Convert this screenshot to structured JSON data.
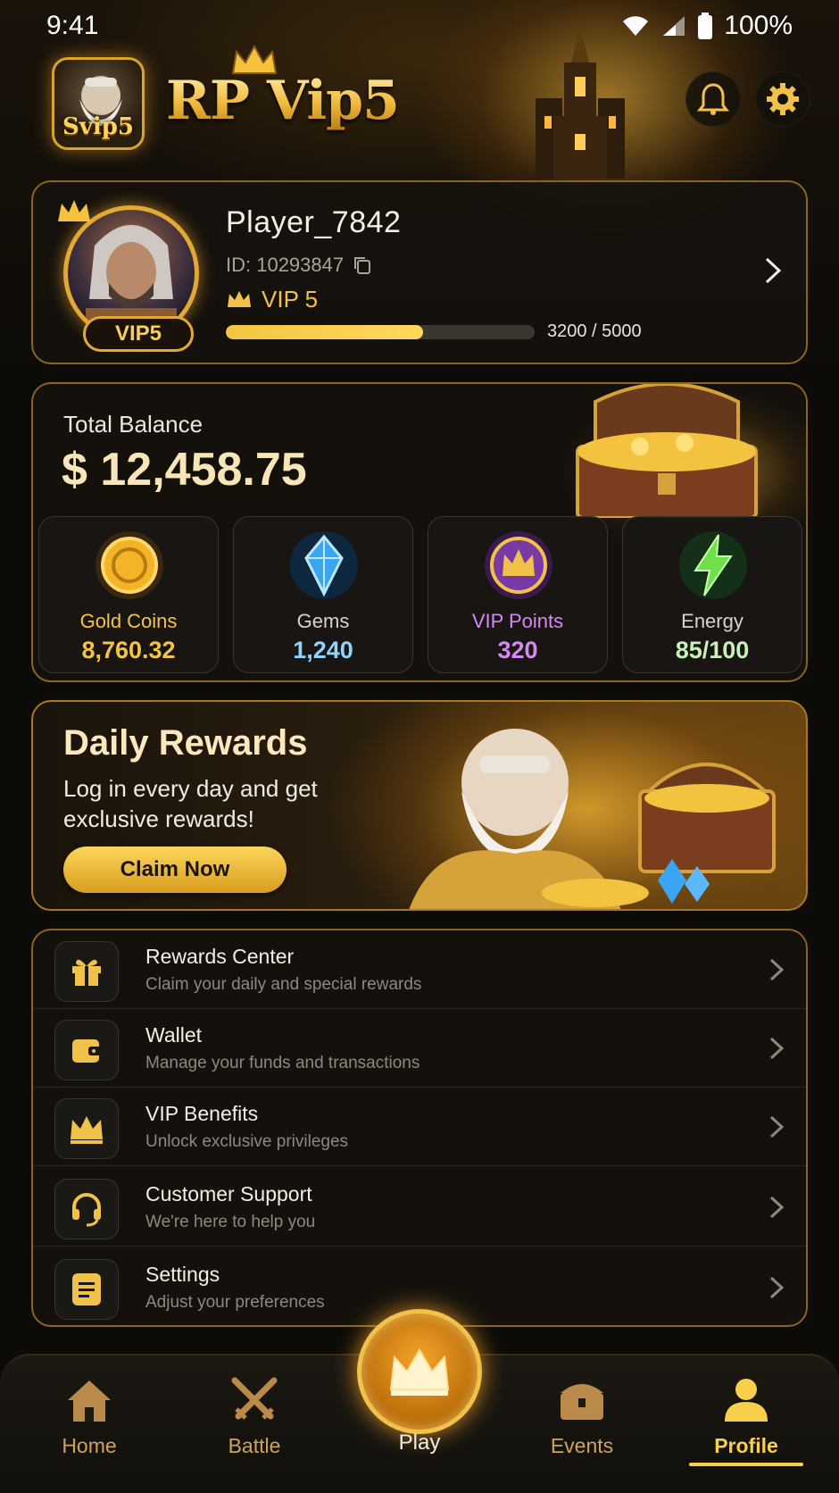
{
  "status_bar": {
    "time": "9:41",
    "battery": "100%"
  },
  "header": {
    "brand_title": "RP Vip5",
    "logo_text": "Svip5"
  },
  "profile": {
    "name": "Player_7842",
    "id_text": "ID: 10293847",
    "vip_badge": "VIP5",
    "vip_level": "VIP 5",
    "progress_text": "3200 / 5000",
    "progress_fraction": 0.64
  },
  "balance": {
    "label": "Total Balance",
    "value": "$ 12,458.75",
    "stats": [
      {
        "label": "Gold Coins",
        "value": "8,760.32",
        "icon": "gold-coin-icon",
        "color": "#f3c447"
      },
      {
        "label": "Gems",
        "value": "1,240",
        "icon": "gem-icon",
        "color": "#8fd3ff"
      },
      {
        "label": "VIP Points",
        "value": "320",
        "icon": "vip-crown-icon",
        "color": "#d58af2"
      },
      {
        "label": "Energy",
        "value": "85/100",
        "icon": "lightning-icon",
        "color": "#c8f0b8"
      }
    ]
  },
  "daily_rewards": {
    "title": "Daily Rewards",
    "subtitle": "Log in every day and get exclusive rewards!",
    "button": "Claim Now"
  },
  "menu": [
    {
      "title": "Rewards Center",
      "subtitle": "Claim your daily and special rewards",
      "icon": "gift-icon"
    },
    {
      "title": "Wallet",
      "subtitle": "Manage your funds and transactions",
      "icon": "wallet-icon"
    },
    {
      "title": "VIP Benefits",
      "subtitle": "Unlock exclusive privileges",
      "icon": "crown-icon"
    },
    {
      "title": "Customer Support",
      "subtitle": "We're here to help you",
      "icon": "headset-icon"
    },
    {
      "title": "Settings",
      "subtitle": "Adjust your preferences",
      "icon": "document-icon"
    }
  ],
  "nav": {
    "home": "Home",
    "battle": "Battle",
    "play": "Play",
    "events": "Events",
    "profile": "Profile",
    "active": "profile"
  },
  "colors": {
    "accent": "#f3c447",
    "background": "#0d0b08"
  }
}
